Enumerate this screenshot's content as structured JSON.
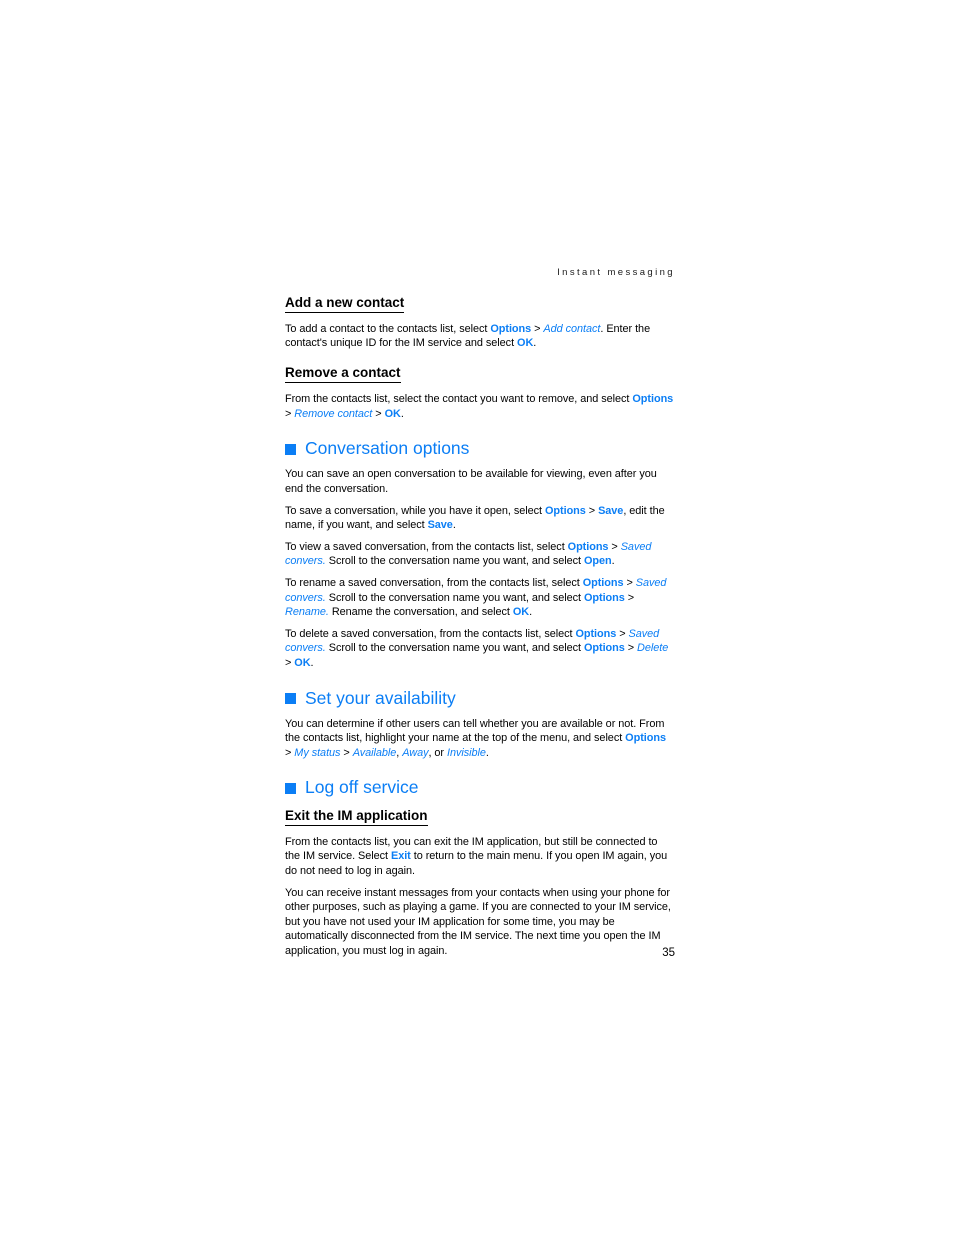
{
  "running_head": "Instant messaging",
  "page_number": "35",
  "colors": {
    "accent_blue": "#0b7ef5",
    "text_black": "#000000",
    "background": "#ffffff"
  },
  "sections": [
    {
      "type": "subheading",
      "title": "Add a new contact",
      "paragraphs": [
        {
          "runs": [
            {
              "text": "To add a contact to the contacts list, select ",
              "style": "plain"
            },
            {
              "text": "Options",
              "style": "bold-blue"
            },
            {
              "text": " > ",
              "style": "plain"
            },
            {
              "text": "Add contact",
              "style": "italic-blue"
            },
            {
              "text": ". Enter the contact's unique ID for the IM service and select ",
              "style": "plain"
            },
            {
              "text": "OK",
              "style": "bold-blue"
            },
            {
              "text": ".",
              "style": "plain"
            }
          ]
        }
      ]
    },
    {
      "type": "subheading",
      "title": "Remove a contact",
      "paragraphs": [
        {
          "runs": [
            {
              "text": "From the contacts list, select the contact you want to remove, and select ",
              "style": "plain"
            },
            {
              "text": "Options",
              "style": "bold-blue"
            },
            {
              "text": " > ",
              "style": "plain"
            },
            {
              "text": "Remove contact",
              "style": "italic-blue"
            },
            {
              "text": " > ",
              "style": "plain"
            },
            {
              "text": "OK",
              "style": "bold-blue"
            },
            {
              "text": ".",
              "style": "plain"
            }
          ]
        }
      ]
    },
    {
      "type": "heading",
      "title": "Conversation options",
      "bullet": "blue-square",
      "paragraphs": [
        {
          "runs": [
            {
              "text": "You can save an open conversation to be available for viewing, even after you end the conversation.",
              "style": "plain"
            }
          ]
        },
        {
          "runs": [
            {
              "text": "To save a conversation, while you have it open, select ",
              "style": "plain"
            },
            {
              "text": "Options",
              "style": "bold-blue"
            },
            {
              "text": " > ",
              "style": "plain"
            },
            {
              "text": "Save",
              "style": "bold-blue"
            },
            {
              "text": ", edit the name, if you want, and select ",
              "style": "plain"
            },
            {
              "text": "Save",
              "style": "bold-blue"
            },
            {
              "text": ".",
              "style": "plain"
            }
          ]
        },
        {
          "runs": [
            {
              "text": "To view a saved conversation, from the contacts list, select ",
              "style": "plain"
            },
            {
              "text": "Options",
              "style": "bold-blue"
            },
            {
              "text": " > ",
              "style": "plain"
            },
            {
              "text": "Saved convers.",
              "style": "italic-blue"
            },
            {
              "text": " Scroll to the conversation name you want, and select ",
              "style": "plain"
            },
            {
              "text": "Open",
              "style": "bold-blue"
            },
            {
              "text": ".",
              "style": "plain"
            }
          ]
        },
        {
          "runs": [
            {
              "text": "To rename a saved conversation, from the contacts list, select ",
              "style": "plain"
            },
            {
              "text": "Options",
              "style": "bold-blue"
            },
            {
              "text": " > ",
              "style": "plain"
            },
            {
              "text": "Saved convers.",
              "style": "italic-blue"
            },
            {
              "text": " Scroll to the conversation name you want, and select ",
              "style": "plain"
            },
            {
              "text": "Options",
              "style": "bold-blue"
            },
            {
              "text": " > ",
              "style": "plain"
            },
            {
              "text": "Rename.",
              "style": "italic-blue"
            },
            {
              "text": " Rename the conversation, and select ",
              "style": "plain"
            },
            {
              "text": "OK",
              "style": "bold-blue"
            },
            {
              "text": ".",
              "style": "plain"
            }
          ]
        },
        {
          "runs": [
            {
              "text": "To delete a saved conversation, from the contacts list, select ",
              "style": "plain"
            },
            {
              "text": "Options",
              "style": "bold-blue"
            },
            {
              "text": " > ",
              "style": "plain"
            },
            {
              "text": "Saved convers.",
              "style": "italic-blue"
            },
            {
              "text": " Scroll to the conversation name you want, and select ",
              "style": "plain"
            },
            {
              "text": "Options",
              "style": "bold-blue"
            },
            {
              "text": " > ",
              "style": "plain"
            },
            {
              "text": "Delete",
              "style": "italic-blue"
            },
            {
              "text": " > ",
              "style": "plain"
            },
            {
              "text": "OK",
              "style": "bold-blue"
            },
            {
              "text": ".",
              "style": "plain"
            }
          ]
        }
      ]
    },
    {
      "type": "heading",
      "title": "Set your availability",
      "bullet": "blue-square",
      "paragraphs": [
        {
          "runs": [
            {
              "text": "You can determine if other users can tell whether you are available or not. From the contacts list, highlight your name at the top of the menu, and select ",
              "style": "plain"
            },
            {
              "text": "Options",
              "style": "bold-blue"
            },
            {
              "text": " > ",
              "style": "plain"
            },
            {
              "text": "My status",
              "style": "italic-blue"
            },
            {
              "text": " > ",
              "style": "plain"
            },
            {
              "text": "Available",
              "style": "italic-blue"
            },
            {
              "text": ", ",
              "style": "plain"
            },
            {
              "text": "Away",
              "style": "italic-blue"
            },
            {
              "text": ", or ",
              "style": "plain"
            },
            {
              "text": "Invisible",
              "style": "italic-blue"
            },
            {
              "text": ".",
              "style": "plain"
            }
          ]
        }
      ]
    },
    {
      "type": "heading",
      "title": "Log off service",
      "bullet": "blue-square",
      "paragraphs": []
    },
    {
      "type": "subheading",
      "title": "Exit the IM application",
      "paragraphs": [
        {
          "runs": [
            {
              "text": "From the contacts list, you can exit the IM application, but still be connected to the IM service. Select ",
              "style": "plain"
            },
            {
              "text": "Exit",
              "style": "bold-blue"
            },
            {
              "text": " to return to the main menu. If you open IM again, you do not need to log in again.",
              "style": "plain"
            }
          ]
        },
        {
          "runs": [
            {
              "text": "You can receive instant messages from your contacts when using your phone for other purposes, such as playing a game. If you are connected to your IM service, but you have not used your IM application for some time, you may be automatically disconnected from the IM service. The next time you open the IM application, you must log in again.",
              "style": "plain"
            }
          ]
        }
      ]
    }
  ]
}
